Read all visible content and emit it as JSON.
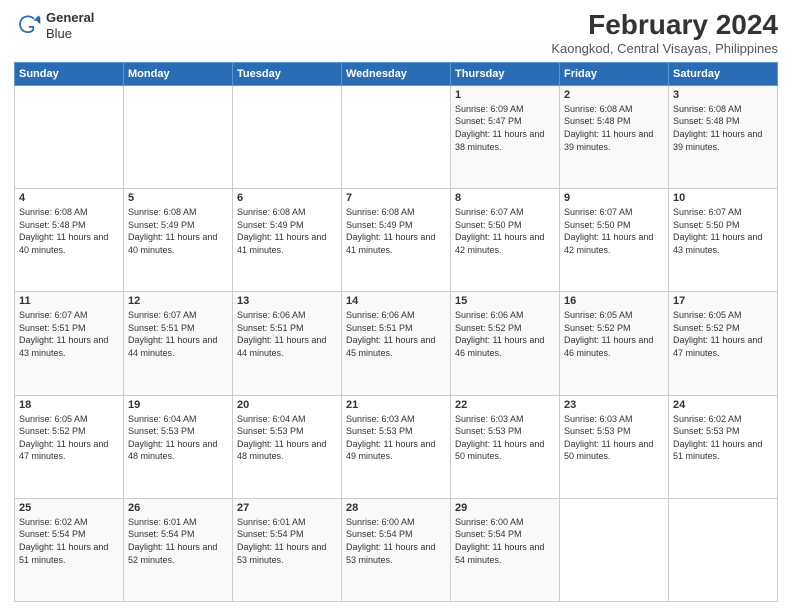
{
  "logo": {
    "line1": "General",
    "line2": "Blue"
  },
  "header": {
    "title": "February 2024",
    "subtitle": "Kaongkod, Central Visayas, Philippines"
  },
  "days_of_week": [
    "Sunday",
    "Monday",
    "Tuesday",
    "Wednesday",
    "Thursday",
    "Friday",
    "Saturday"
  ],
  "weeks": [
    [
      {
        "day": "",
        "info": ""
      },
      {
        "day": "",
        "info": ""
      },
      {
        "day": "",
        "info": ""
      },
      {
        "day": "",
        "info": ""
      },
      {
        "day": "1",
        "info": "Sunrise: 6:09 AM\nSunset: 5:47 PM\nDaylight: 11 hours\nand 38 minutes."
      },
      {
        "day": "2",
        "info": "Sunrise: 6:08 AM\nSunset: 5:48 PM\nDaylight: 11 hours\nand 39 minutes."
      },
      {
        "day": "3",
        "info": "Sunrise: 6:08 AM\nSunset: 5:48 PM\nDaylight: 11 hours\nand 39 minutes."
      }
    ],
    [
      {
        "day": "4",
        "info": "Sunrise: 6:08 AM\nSunset: 5:48 PM\nDaylight: 11 hours\nand 40 minutes."
      },
      {
        "day": "5",
        "info": "Sunrise: 6:08 AM\nSunset: 5:49 PM\nDaylight: 11 hours\nand 40 minutes."
      },
      {
        "day": "6",
        "info": "Sunrise: 6:08 AM\nSunset: 5:49 PM\nDaylight: 11 hours\nand 41 minutes."
      },
      {
        "day": "7",
        "info": "Sunrise: 6:08 AM\nSunset: 5:49 PM\nDaylight: 11 hours\nand 41 minutes."
      },
      {
        "day": "8",
        "info": "Sunrise: 6:07 AM\nSunset: 5:50 PM\nDaylight: 11 hours\nand 42 minutes."
      },
      {
        "day": "9",
        "info": "Sunrise: 6:07 AM\nSunset: 5:50 PM\nDaylight: 11 hours\nand 42 minutes."
      },
      {
        "day": "10",
        "info": "Sunrise: 6:07 AM\nSunset: 5:50 PM\nDaylight: 11 hours\nand 43 minutes."
      }
    ],
    [
      {
        "day": "11",
        "info": "Sunrise: 6:07 AM\nSunset: 5:51 PM\nDaylight: 11 hours\nand 43 minutes."
      },
      {
        "day": "12",
        "info": "Sunrise: 6:07 AM\nSunset: 5:51 PM\nDaylight: 11 hours\nand 44 minutes."
      },
      {
        "day": "13",
        "info": "Sunrise: 6:06 AM\nSunset: 5:51 PM\nDaylight: 11 hours\nand 44 minutes."
      },
      {
        "day": "14",
        "info": "Sunrise: 6:06 AM\nSunset: 5:51 PM\nDaylight: 11 hours\nand 45 minutes."
      },
      {
        "day": "15",
        "info": "Sunrise: 6:06 AM\nSunset: 5:52 PM\nDaylight: 11 hours\nand 46 minutes."
      },
      {
        "day": "16",
        "info": "Sunrise: 6:05 AM\nSunset: 5:52 PM\nDaylight: 11 hours\nand 46 minutes."
      },
      {
        "day": "17",
        "info": "Sunrise: 6:05 AM\nSunset: 5:52 PM\nDaylight: 11 hours\nand 47 minutes."
      }
    ],
    [
      {
        "day": "18",
        "info": "Sunrise: 6:05 AM\nSunset: 5:52 PM\nDaylight: 11 hours\nand 47 minutes."
      },
      {
        "day": "19",
        "info": "Sunrise: 6:04 AM\nSunset: 5:53 PM\nDaylight: 11 hours\nand 48 minutes."
      },
      {
        "day": "20",
        "info": "Sunrise: 6:04 AM\nSunset: 5:53 PM\nDaylight: 11 hours\nand 48 minutes."
      },
      {
        "day": "21",
        "info": "Sunrise: 6:03 AM\nSunset: 5:53 PM\nDaylight: 11 hours\nand 49 minutes."
      },
      {
        "day": "22",
        "info": "Sunrise: 6:03 AM\nSunset: 5:53 PM\nDaylight: 11 hours\nand 50 minutes."
      },
      {
        "day": "23",
        "info": "Sunrise: 6:03 AM\nSunset: 5:53 PM\nDaylight: 11 hours\nand 50 minutes."
      },
      {
        "day": "24",
        "info": "Sunrise: 6:02 AM\nSunset: 5:53 PM\nDaylight: 11 hours\nand 51 minutes."
      }
    ],
    [
      {
        "day": "25",
        "info": "Sunrise: 6:02 AM\nSunset: 5:54 PM\nDaylight: 11 hours\nand 51 minutes."
      },
      {
        "day": "26",
        "info": "Sunrise: 6:01 AM\nSunset: 5:54 PM\nDaylight: 11 hours\nand 52 minutes."
      },
      {
        "day": "27",
        "info": "Sunrise: 6:01 AM\nSunset: 5:54 PM\nDaylight: 11 hours\nand 53 minutes."
      },
      {
        "day": "28",
        "info": "Sunrise: 6:00 AM\nSunset: 5:54 PM\nDaylight: 11 hours\nand 53 minutes."
      },
      {
        "day": "29",
        "info": "Sunrise: 6:00 AM\nSunset: 5:54 PM\nDaylight: 11 hours\nand 54 minutes."
      },
      {
        "day": "",
        "info": ""
      },
      {
        "day": "",
        "info": ""
      }
    ]
  ]
}
